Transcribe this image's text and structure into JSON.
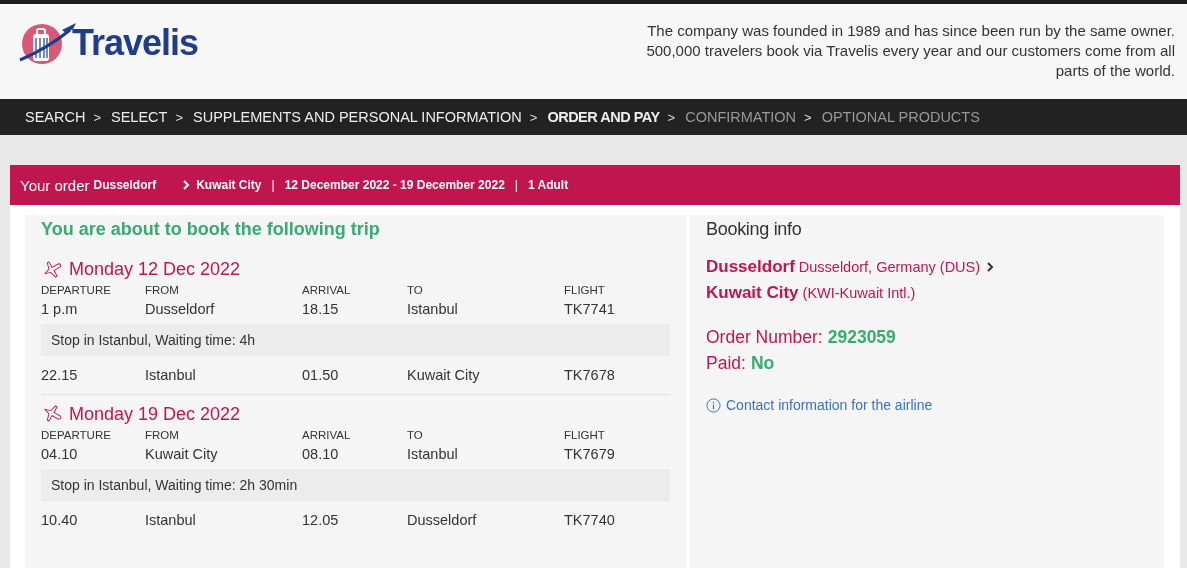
{
  "header": {
    "logo_text": "Travelis",
    "about": "The company was founded in 1989 and has since been run by the same owner. 500,000 travelers book via Travelis every year and our customers come from all parts of the world."
  },
  "steps": [
    {
      "label": "SEARCH",
      "separator": ">",
      "selected": false,
      "disabled": false
    },
    {
      "label": "SELECT",
      "separator": ">",
      "selected": false,
      "disabled": false
    },
    {
      "label": "SUPPLEMENTS AND PERSONAL INFORMATION",
      "separator": ">",
      "selected": false,
      "disabled": false
    },
    {
      "label": "ORDER AND PAY",
      "separator": ">",
      "selected": true,
      "disabled": false
    },
    {
      "label": "CONFIRMATION",
      "separator": ">",
      "selected": false,
      "disabled": true
    },
    {
      "label": "OPTIONAL PRODUCTS",
      "selected": false,
      "disabled": true
    }
  ],
  "order_bar": {
    "title": "Your order",
    "origin": "Dusseldorf",
    "destination": "Kuwait City",
    "details": [
      {
        "separator": "|",
        "text": "12 December 2022 - 19 December 2022"
      },
      {
        "separator": "|",
        "text": "1 Adult"
      }
    ]
  },
  "trip": {
    "heading": "You are about to book the following trip",
    "legs": [
      {
        "kind": "outbound",
        "date": "Monday 12 Dec 2022",
        "columns": [
          "DEPARTURE",
          "FROM",
          "ARRIVAL",
          "TO",
          "FLIGHT"
        ],
        "segments": [
          {
            "departure": "1 p.m",
            "from": "Dusseldorf",
            "arrival": "18.15",
            "to": "Istanbul",
            "flight": "TK7741",
            "stop": "Stop in Istanbul, Waiting time: 4h"
          },
          {
            "departure": "22.15",
            "from": "Istanbul",
            "arrival": "01.50",
            "to": "Kuwait City",
            "flight": "TK7678"
          }
        ]
      },
      {
        "kind": "return",
        "date": "Monday 19 Dec 2022",
        "columns": [
          "DEPARTURE",
          "FROM",
          "ARRIVAL",
          "TO",
          "FLIGHT"
        ],
        "segments": [
          {
            "departure": "04.10",
            "from": "Kuwait City",
            "arrival": "08.10",
            "to": "Istanbul",
            "flight": "TK7679",
            "stop": "Stop in Istanbul, Waiting time: 2h 30min"
          },
          {
            "departure": "10.40",
            "from": "Istanbul",
            "arrival": "12.05",
            "to": "Dusseldorf",
            "flight": "TK7740"
          }
        ]
      }
    ]
  },
  "booking_info": {
    "title": "Booking info",
    "origin": {
      "city": "Dusseldorf",
      "airport": "Dusseldorf, Germany (DUS)"
    },
    "destination": {
      "city": "Kuwait City",
      "airport": "(KWI-Kuwait Intl.)"
    },
    "order_number": {
      "label": "Order Number:",
      "value": "2923059"
    },
    "paid": {
      "label": "Paid:",
      "value": "No"
    },
    "contact_link": "Contact information for the airline"
  }
}
